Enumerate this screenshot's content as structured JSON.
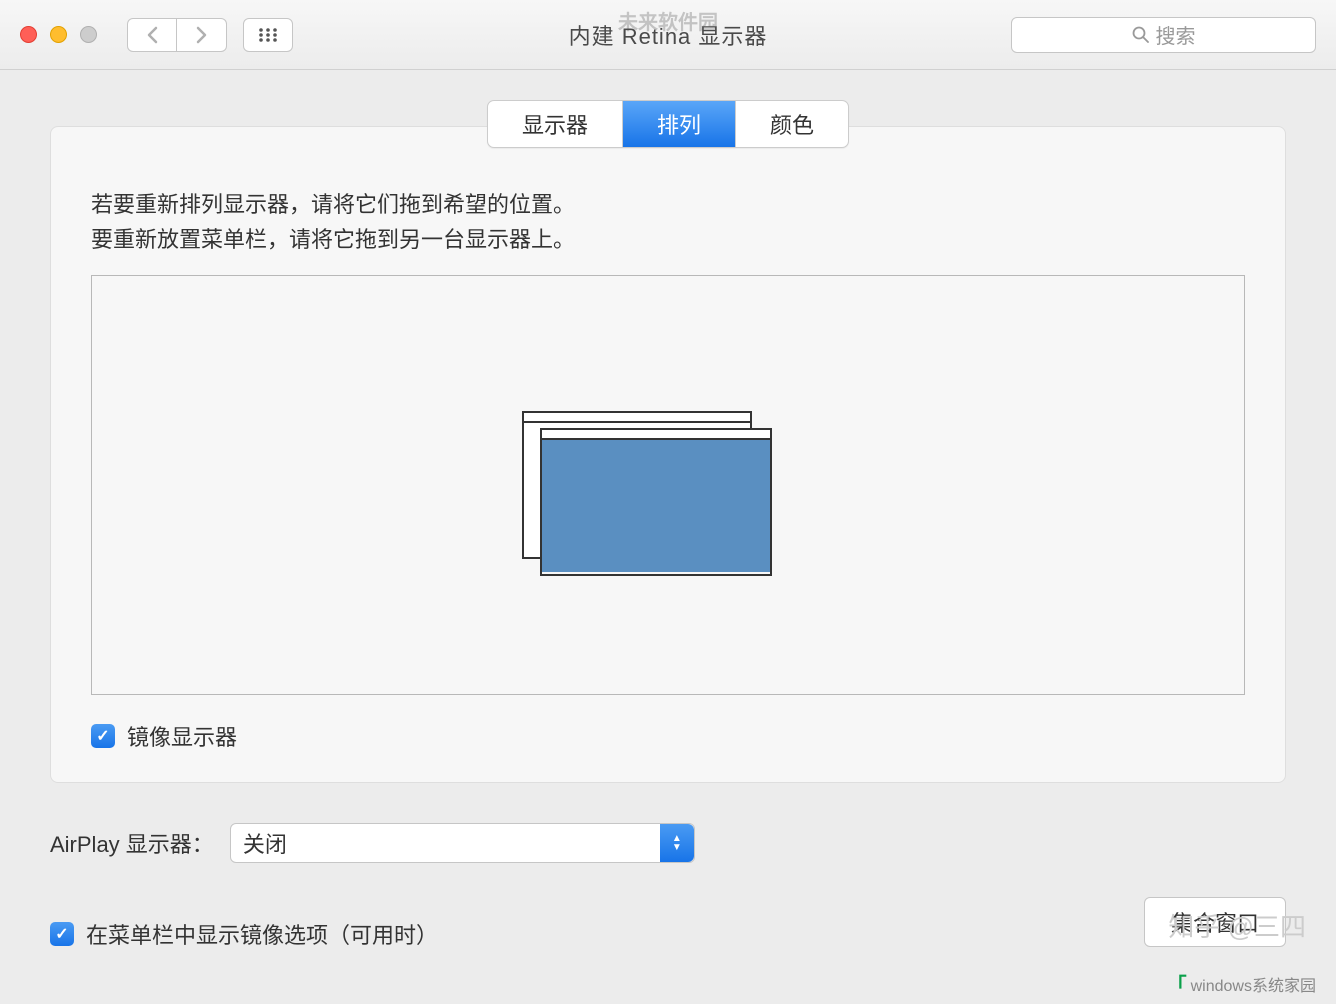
{
  "window": {
    "title": "内建 Retina 显示器"
  },
  "search": {
    "placeholder": "搜索"
  },
  "tabs": {
    "display": "显示器",
    "arrangement": "排列",
    "color": "颜色"
  },
  "instructions": {
    "line1": "若要重新排列显示器，请将它们拖到希望的位置。",
    "line2": "要重新放置菜单栏，请将它拖到另一台显示器上。"
  },
  "mirror": {
    "label": "镜像显示器",
    "checked": true
  },
  "airplay": {
    "label": "AirPlay 显示器：",
    "value": "关闭"
  },
  "menubar_option": {
    "label": "在菜单栏中显示镜像选项（可用时）",
    "checked": true
  },
  "gather_button": "集合窗口",
  "watermarks": {
    "top": "未来软件园",
    "right": "知乎 @三四",
    "bottom": "windows系统家园"
  }
}
